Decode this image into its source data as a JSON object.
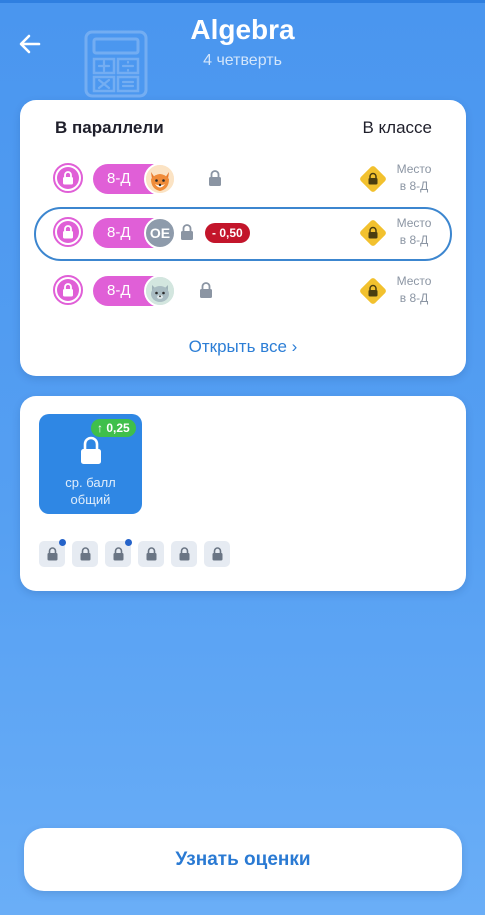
{
  "header": {
    "title": "Algebra",
    "subtitle": "4 четверть",
    "back_icon": "arrow-left-icon",
    "watermark_icon": "calculator-icon"
  },
  "ranking": {
    "parallel_label": "В параллели",
    "class_label": "В классе",
    "rows": [
      {
        "group": "8-Д",
        "avatar": "fox",
        "avatar_text": "",
        "delta": "",
        "place_line1": "Место",
        "place_line2": "в 8-Д",
        "selected": false
      },
      {
        "group": "8-Д",
        "avatar": "initials",
        "avatar_text": "OE",
        "delta": "- 0,50",
        "place_line1": "Место",
        "place_line2": "в 8-Д",
        "selected": true
      },
      {
        "group": "8-Д",
        "avatar": "cat",
        "avatar_text": "",
        "delta": "",
        "place_line1": "Место",
        "place_line2": "в 8-Д",
        "selected": false
      }
    ],
    "open_all_label": "Открыть все ›"
  },
  "grades": {
    "tile_badge": "↑ 0,25",
    "tile_label_line1": "ср. балл",
    "tile_label_line2": "общий",
    "slots": [
      {
        "dot": true
      },
      {
        "dot": false
      },
      {
        "dot": true
      },
      {
        "dot": false
      },
      {
        "dot": false
      },
      {
        "dot": false
      }
    ]
  },
  "action": {
    "button_label": "Узнать оценки"
  },
  "colors": {
    "accent_pink": "#e05fd7",
    "accent_blue": "#2c7ed6",
    "badge_red": "#c3152b",
    "badge_green": "#3fbf4b",
    "place_gold": "#f2c12e"
  }
}
